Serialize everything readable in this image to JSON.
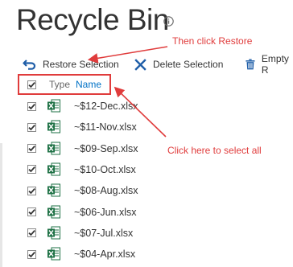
{
  "page": {
    "title": "Recycle Bin"
  },
  "toolbar": {
    "restore_label": "Restore Selection",
    "delete_label": "Delete Selection",
    "empty_label": "Empty R"
  },
  "list": {
    "columns": [
      "Type",
      "Name"
    ],
    "rows": [
      {
        "name": "~$12-Dec.xlsx",
        "checked": true
      },
      {
        "name": "~$11-Nov.xlsx",
        "checked": true
      },
      {
        "name": "~$09-Sep.xlsx",
        "checked": true
      },
      {
        "name": "~$10-Oct.xlsx",
        "checked": true
      },
      {
        "name": "~$08-Aug.xlsx",
        "checked": true
      },
      {
        "name": "~$06-Jun.xlsx",
        "checked": true
      },
      {
        "name": "~$07-Jul.xlsx",
        "checked": true
      },
      {
        "name": "~$04-Apr.xlsx",
        "checked": true
      }
    ]
  },
  "annotations": {
    "restore_note": "Then click Restore",
    "select_all_note": "Click here to select all",
    "color": "#e03c3c"
  },
  "colors": {
    "link_blue": "#0072c6",
    "excel_green": "#1e7145",
    "icon_blue": "#1f5ea8"
  }
}
